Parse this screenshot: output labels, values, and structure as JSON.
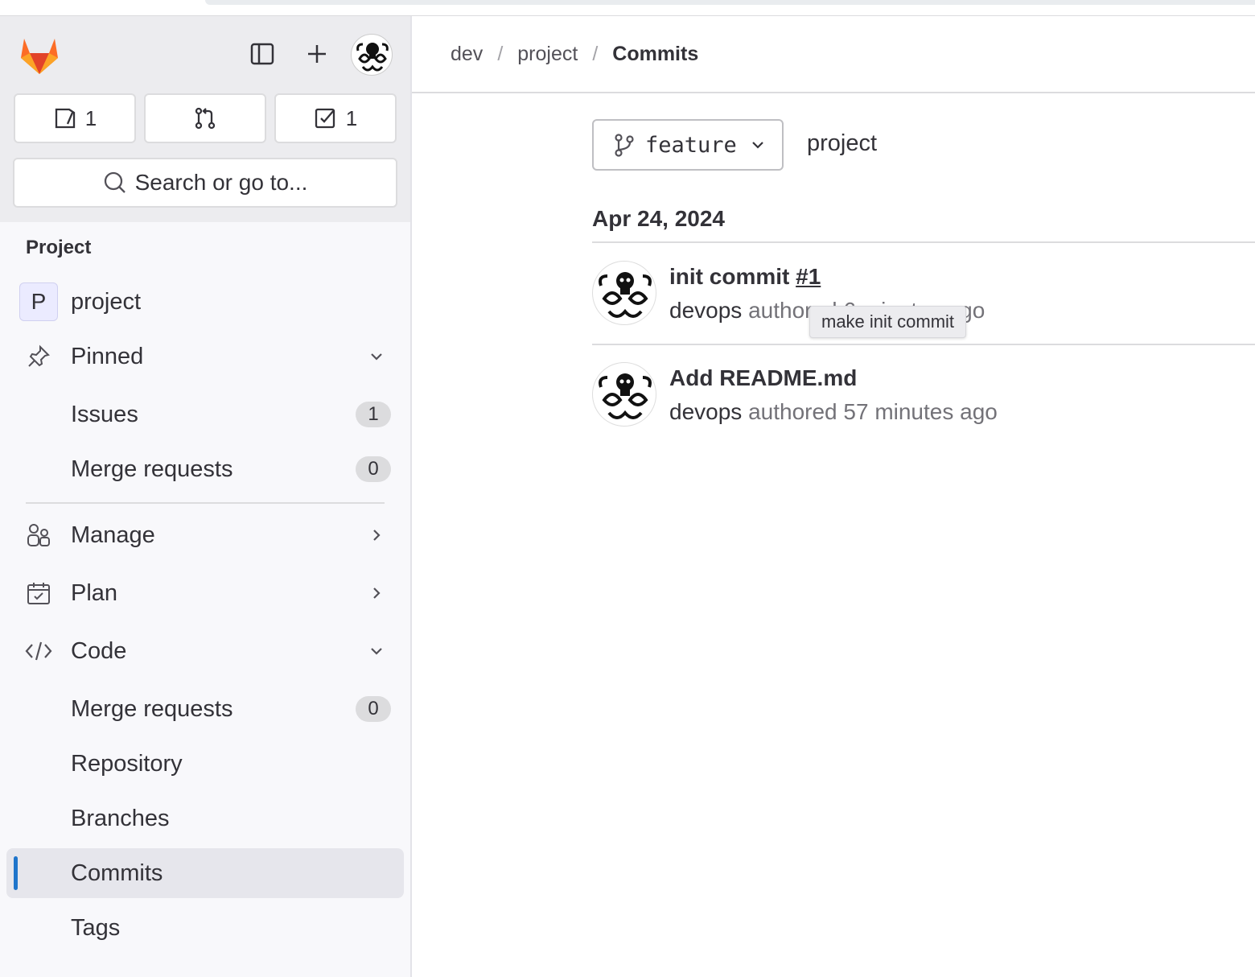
{
  "sidebar": {
    "counts": {
      "issues": "1",
      "todos": "1"
    },
    "search_placeholder": "Search or go to...",
    "section_label": "Project",
    "project": {
      "avatar_letter": "P",
      "name": "project"
    },
    "pinned": {
      "label": "Pinned",
      "items": [
        {
          "label": "Issues",
          "badge": "1"
        },
        {
          "label": "Merge requests",
          "badge": "0"
        }
      ]
    },
    "manage": "Manage",
    "plan": "Plan",
    "code": {
      "label": "Code",
      "items": [
        {
          "label": "Merge requests",
          "badge": "0"
        },
        {
          "label": "Repository"
        },
        {
          "label": "Branches"
        },
        {
          "label": "Commits"
        },
        {
          "label": "Tags"
        }
      ]
    }
  },
  "breadcrumb": [
    "dev",
    "project",
    "Commits"
  ],
  "branch": {
    "name": "feature"
  },
  "path_label": "project",
  "date_header": "Apr 24, 2024",
  "commits": [
    {
      "title": "init commit",
      "ref": "#1",
      "author": "devops",
      "authored": "authored 6 minutes ago"
    },
    {
      "title": "Add README.md",
      "ref": "",
      "author": "devops",
      "authored": "authored 57 minutes ago"
    }
  ],
  "tooltip": "make init commit",
  "colors": {
    "brand_orange": "#e24329",
    "active_bar": "#1f75cb"
  }
}
